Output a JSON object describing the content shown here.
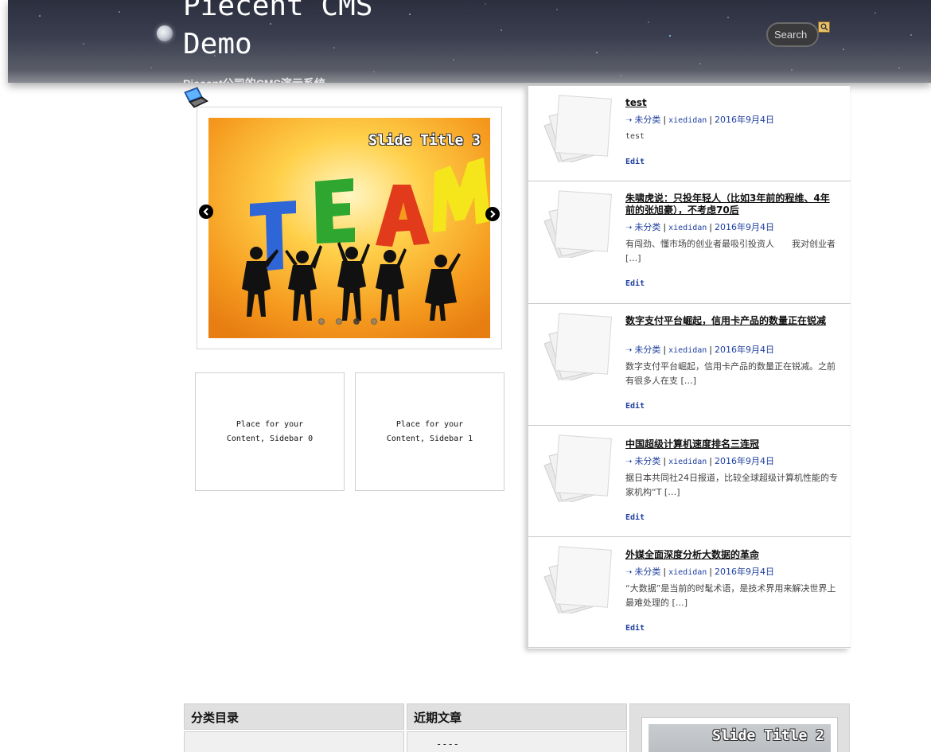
{
  "header": {
    "site_title": "Piecent CMS\nDemo",
    "site_description": "Piecent公司的CMS演示系统",
    "search_placeholder": "Search",
    "search_icon": "magnifier-icon"
  },
  "slider": {
    "slide_title": "Slide Title 3",
    "slide_text": "TEAM",
    "prev_icon": "arrow-left-icon",
    "next_icon": "arrow-right-icon",
    "dot_count": 4,
    "active_dot": 3
  },
  "sidebars": [
    {
      "label": "Place for your\nContent, Sidebar 0"
    },
    {
      "label": "Place for your\nContent, Sidebar 1"
    }
  ],
  "posts": [
    {
      "title": "test",
      "category": "未分类",
      "author": "xiedidan",
      "date": "2016年9月4日",
      "excerpt": "test",
      "edit_label": "Edit"
    },
    {
      "title": "朱啸虎说：只投年轻人（比如3年前的程维、4年前的张旭豪），不考虑70后",
      "category": "未分类",
      "author": "xiedidan",
      "date": "2016年9月4日",
      "excerpt": "有闯劲、懂市场的创业者最吸引投资人　　我对创业者 […]",
      "edit_label": "Edit"
    },
    {
      "title": "数字支付平台崛起，信用卡产品的数量正在锐减",
      "category": "未分类",
      "author": "xiedidan",
      "date": "2016年9月4日",
      "excerpt": "数字支付平台崛起，信用卡产品的数量正在锐减。之前有很多人在支 […]",
      "edit_label": "Edit"
    },
    {
      "title": "中国超级计算机速度排名三连冠",
      "category": "未分类",
      "author": "xiedidan",
      "date": "2016年9月4日",
      "excerpt": "据日本共同社24日报道，比较全球超级计算机性能的专家机构“T […]",
      "edit_label": "Edit"
    },
    {
      "title": "外媒全面深度分析大数据的革命",
      "category": "未分类",
      "author": "xiedidan",
      "date": "2016年9月4日",
      "excerpt": "“大数据”是当前的时髦术语，是技术界用来解决世界上最难处理的 […]",
      "edit_label": "Edit"
    }
  ],
  "footer": {
    "categories_heading": "分类目录",
    "recent_heading": "近期文章",
    "recent_first": "----",
    "slider_title": "Slide Title 2"
  }
}
